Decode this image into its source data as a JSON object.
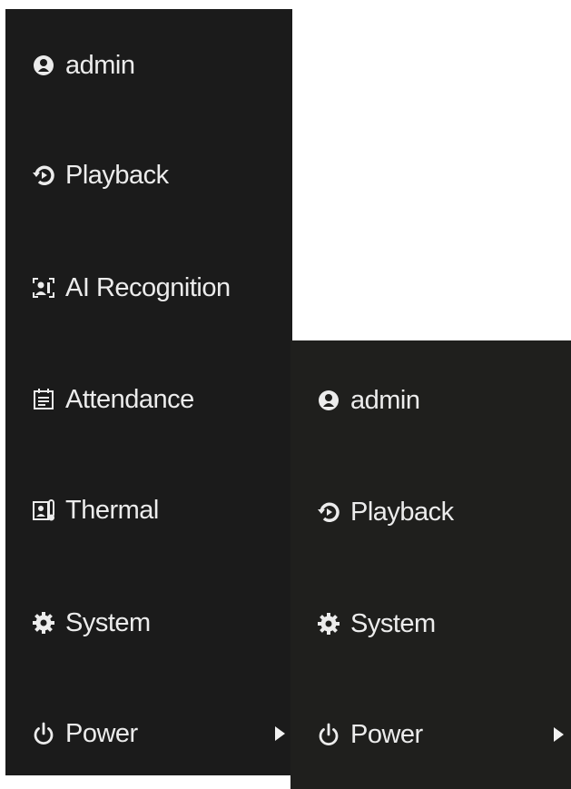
{
  "left_menu": {
    "items": [
      {
        "label": "admin",
        "icon": "user-icon"
      },
      {
        "label": "Playback",
        "icon": "playback-icon"
      },
      {
        "label": "AI Recognition",
        "icon": "face-recognition-icon"
      },
      {
        "label": "Attendance",
        "icon": "calendar-icon"
      },
      {
        "label": "Thermal",
        "icon": "thermal-icon"
      },
      {
        "label": "System",
        "icon": "gear-icon"
      },
      {
        "label": "Power",
        "icon": "power-icon",
        "has_submenu": true
      }
    ]
  },
  "right_menu": {
    "items": [
      {
        "label": "admin",
        "icon": "user-icon"
      },
      {
        "label": "Playback",
        "icon": "playback-icon"
      },
      {
        "label": "System",
        "icon": "gear-icon"
      },
      {
        "label": "Power",
        "icon": "power-icon",
        "has_submenu": true
      }
    ]
  },
  "colors": {
    "menu_background": "#1b1b1b",
    "text": "#ececec"
  }
}
